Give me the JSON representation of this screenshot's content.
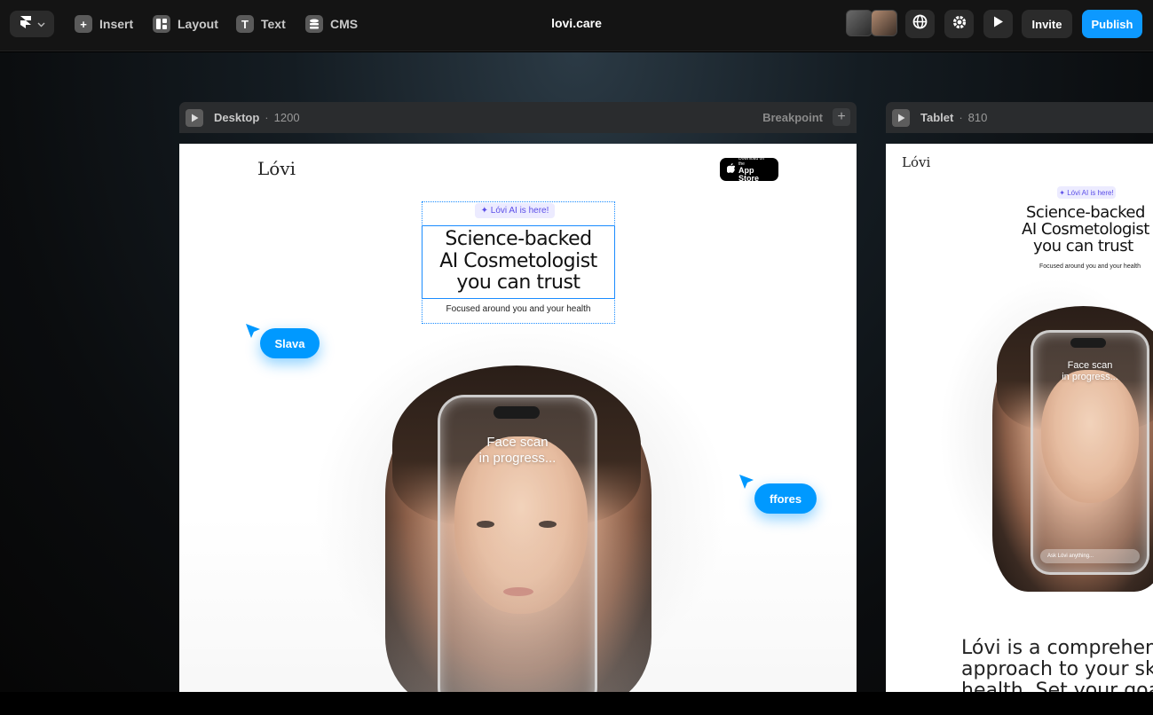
{
  "toolbar": {
    "insert_label": "Insert",
    "layout_label": "Layout",
    "text_label": "Text",
    "cms_label": "CMS",
    "project_title": "lovi.care",
    "invite_label": "Invite",
    "publish_label": "Publish",
    "icons": {
      "logo": "framer-logo-icon",
      "insert": "plus-icon",
      "layout": "layout-icon",
      "text": "text-icon",
      "cms": "database-icon",
      "globe": "globe-icon",
      "settings": "gear-icon",
      "preview": "play-icon"
    },
    "accent_color": "#0d99ff"
  },
  "frames": {
    "desktop": {
      "label": "Desktop",
      "separator": "·",
      "width_label": "1200",
      "breakpoint_label": "Breakpoint",
      "add_label": "+"
    },
    "tablet": {
      "label": "Tablet",
      "separator": "·",
      "width_label": "810"
    }
  },
  "site": {
    "logo": "Lóvi",
    "app_store_small": "Download on the",
    "app_store_big": "App Store",
    "badge": "✦ Lóvi AI is here!",
    "headline_1": "Science-backed",
    "headline_2": "AI Cosmetologist",
    "headline_3": "you can trust",
    "subhead": "Focused around you and your health",
    "phone_text_1": "Face scan",
    "phone_text_2": "in progress...",
    "ask_placeholder": "Ask Lóvi anything...",
    "tablet_headline_2": "AI Cosmetologist",
    "tablet_para_1": "Lóvi is a comprehen",
    "tablet_para_2": "approach to your sk",
    "tablet_para_3": "health. Set your goa"
  },
  "collaborators": {
    "cursor_1": "Slava",
    "cursor_2": "ffores",
    "cursor_color": "#0099ff"
  }
}
